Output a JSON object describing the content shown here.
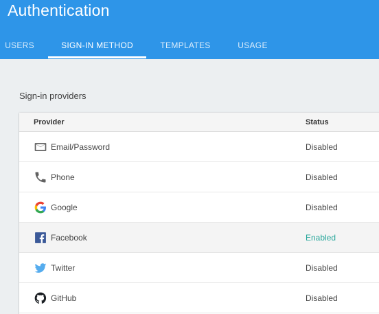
{
  "header": {
    "title": "Authentication",
    "tabs": [
      {
        "label": "USERS"
      },
      {
        "label": "SIGN-IN METHOD",
        "active": true
      },
      {
        "label": "TEMPLATES"
      },
      {
        "label": "USAGE"
      }
    ]
  },
  "section": {
    "label": "Sign-in providers"
  },
  "table": {
    "columns": [
      "Provider",
      "Status"
    ],
    "rows": [
      {
        "icon": "email-icon",
        "provider": "Email/Password",
        "status": "Disabled"
      },
      {
        "icon": "phone-icon",
        "provider": "Phone",
        "status": "Disabled"
      },
      {
        "icon": "google-icon",
        "provider": "Google",
        "status": "Disabled"
      },
      {
        "icon": "facebook-icon",
        "provider": "Facebook",
        "status": "Enabled"
      },
      {
        "icon": "twitter-icon",
        "provider": "Twitter",
        "status": "Disabled"
      },
      {
        "icon": "github-icon",
        "provider": "GitHub",
        "status": "Disabled"
      }
    ]
  },
  "colors": {
    "header": "#2e95e8",
    "enabled": "#26a69a",
    "twitter": "#55acee",
    "facebook": "#3b5998"
  }
}
